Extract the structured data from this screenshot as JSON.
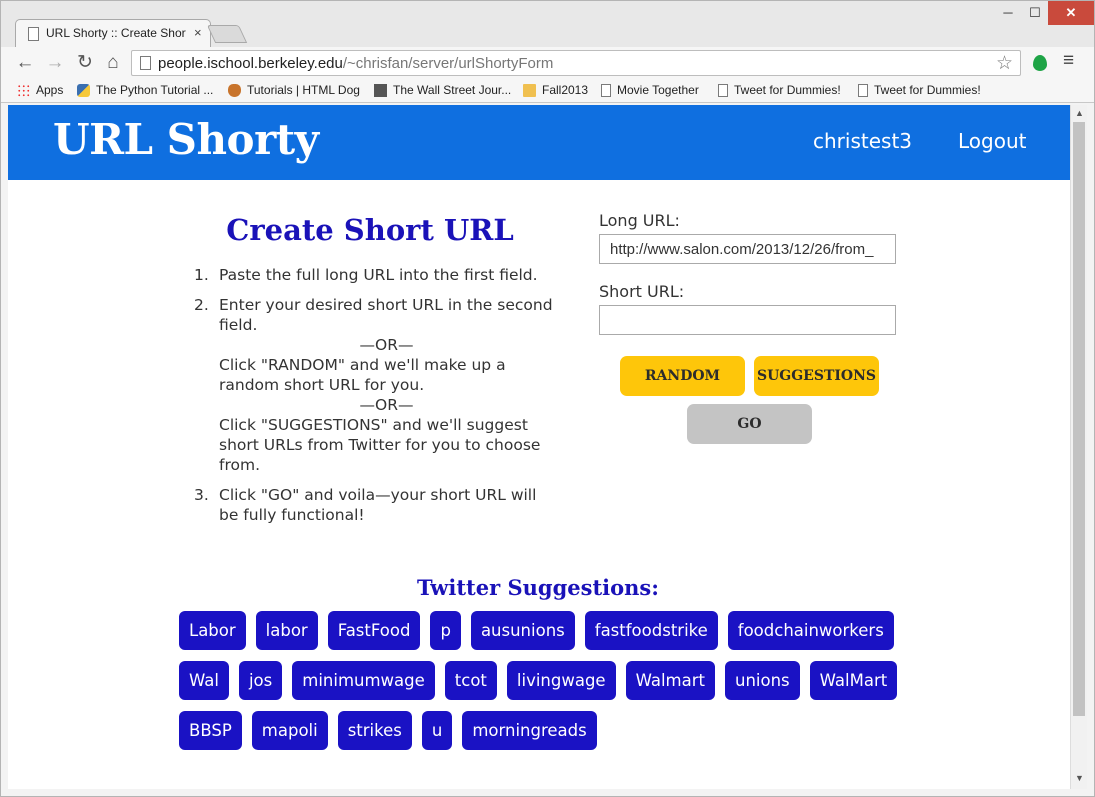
{
  "browser": {
    "tab_title": "URL Shorty :: Create Short",
    "tab_close": "×",
    "window_controls": {
      "minimize": "─",
      "maximize": "☐",
      "close": "✕"
    },
    "nav": {
      "back": "←",
      "forward": "→",
      "reload": "↻",
      "home": "⌂"
    },
    "url_host": "people.ischool.berkeley.edu",
    "url_path": "/~chrisfan/server/urlShortyForm",
    "star": "☆",
    "menu": "≡",
    "bookmarks": [
      {
        "label": "Apps",
        "icon": "apps-icon"
      },
      {
        "label": "The Python Tutorial ...",
        "icon": "python-icon"
      },
      {
        "label": "Tutorials | HTML Dog",
        "icon": "htmldog-icon"
      },
      {
        "label": "The Wall Street Jour...",
        "icon": "wsj-icon"
      },
      {
        "label": "Fall2013",
        "icon": "folder-icon"
      },
      {
        "label": "Movie Together",
        "icon": "page-icon"
      },
      {
        "label": "Tweet for Dummies!",
        "icon": "page-icon"
      },
      {
        "label": "Tweet for Dummies!",
        "icon": "page-icon"
      }
    ]
  },
  "header": {
    "title": "URL Shorty",
    "username": "christest3",
    "logout": "Logout"
  },
  "instructions": {
    "heading": "Create Short URL",
    "step1": "Paste the full long URL into the first field.",
    "step2_a": "Enter your desired short URL in the second field.",
    "or": "—OR—",
    "step2_b": "Click \"RANDOM\" and we'll make up a random short URL for you.",
    "step2_c": "Click \"SUGGESTIONS\" and we'll suggest short URLs from Twitter for you to choose from.",
    "step3": "Click \"GO\" and voila—your short URL will be fully functional!"
  },
  "form": {
    "long_label": "Long URL:",
    "long_value": "http://www.salon.com/2013/12/26/from_",
    "short_label": "Short URL:",
    "short_value": "",
    "random_button": "RANDOM",
    "suggestions_button": "SUGGESTIONS",
    "go_button": "GO"
  },
  "suggestions": {
    "heading": "Twitter Suggestions:",
    "tags": [
      "Labor",
      "labor",
      "FastFood",
      "p",
      "ausunions",
      "fastfoodstrike",
      "foodchainworkers",
      "Wal",
      "jos",
      "minimumwage",
      "tcot",
      "livingwage",
      "Walmart",
      "unions",
      "WalMart",
      "BBSP",
      "mapoli",
      "strikes",
      "u",
      "morningreads"
    ]
  },
  "colors": {
    "header_bg": "#0f6fe0",
    "heading_text": "#1a12b8",
    "tag_bg": "#1a12c4",
    "yellow_button": "#fec60a",
    "gray_button": "#c4c4c4"
  }
}
